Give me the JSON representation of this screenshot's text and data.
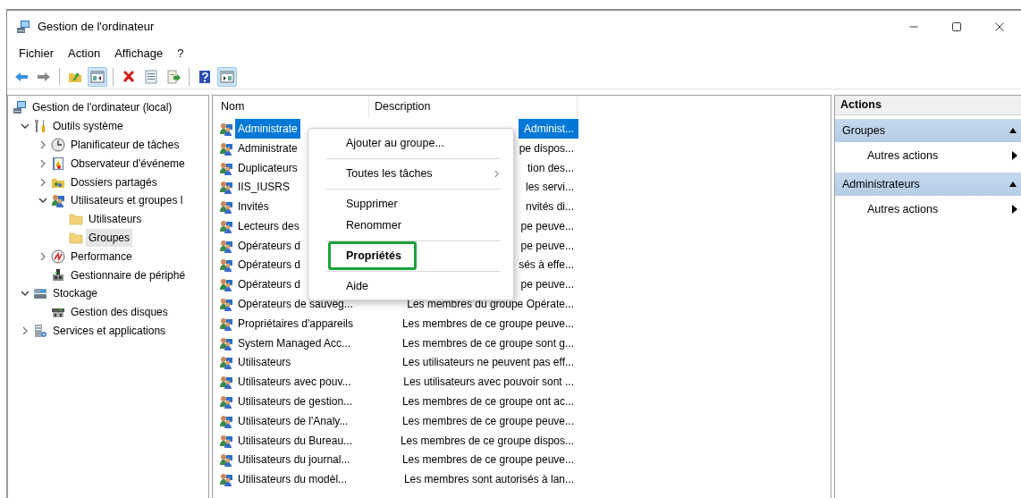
{
  "window": {
    "title": "Gestion de l'ordinateur"
  },
  "menu_bar": [
    "Fichier",
    "Action",
    "Affichage",
    "?"
  ],
  "toolbar": [
    {
      "kind": "back",
      "pressed": false
    },
    {
      "kind": "forward",
      "pressed": false
    },
    {
      "kind": "separator"
    },
    {
      "kind": "up",
      "pressed": false
    },
    {
      "kind": "tree-toggle",
      "pressed": true
    },
    {
      "kind": "separator"
    },
    {
      "kind": "delete",
      "pressed": false
    },
    {
      "kind": "properties",
      "pressed": false
    },
    {
      "kind": "export",
      "pressed": false
    },
    {
      "kind": "separator"
    },
    {
      "kind": "help",
      "pressed": false
    },
    {
      "kind": "actions-toggle",
      "pressed": true
    }
  ],
  "tree": [
    {
      "label": "Gestion de l'ordinateur (local)",
      "kind": "computer",
      "selected": false,
      "children": [
        {
          "label": "Outils système",
          "kind": "tools",
          "expanded": true,
          "selected": false,
          "children": [
            {
              "label": "Planificateur de tâches",
              "kind": "clock",
              "expanded": false,
              "selected": false
            },
            {
              "label": "Observateur d'événeme",
              "kind": "event",
              "expanded": false,
              "selected": false
            },
            {
              "label": "Dossiers partagés",
              "kind": "share",
              "expanded": false,
              "selected": false
            },
            {
              "label": "Utilisateurs et groupes l",
              "kind": "users",
              "expanded": true,
              "selected": false,
              "children": [
                {
                  "label": "Utilisateurs",
                  "kind": "folder",
                  "selected": false
                },
                {
                  "label": "Groupes",
                  "kind": "folder",
                  "selected": true
                }
              ]
            },
            {
              "label": "Performance",
              "kind": "perf",
              "expanded": false,
              "selected": false
            },
            {
              "label": "Gestionnaire de périphé",
              "kind": "device",
              "selected": false
            }
          ]
        },
        {
          "label": "Stockage",
          "kind": "storage",
          "expanded": true,
          "selected": false,
          "children": [
            {
              "label": "Gestion des disques",
              "kind": "disk",
              "selected": false
            }
          ]
        },
        {
          "label": "Services et applications",
          "kind": "services",
          "expanded": false,
          "selected": false
        }
      ]
    }
  ],
  "table": {
    "columns": [
      "Nom",
      "Description"
    ],
    "rows": [
      {
        "name": "Administrate",
        "description": "Administ...",
        "selected": true
      },
      {
        "name": "Administrate",
        "description": "pe dispos...",
        "selected": false
      },
      {
        "name": "Duplicateurs",
        "description": "tion des...",
        "selected": false
      },
      {
        "name": "IIS_IUSRS",
        "description": "les servi...",
        "selected": false
      },
      {
        "name": "Invités",
        "description": "nvités di...",
        "selected": false
      },
      {
        "name": "Lecteurs des",
        "description": "pe peuve...",
        "selected": false
      },
      {
        "name": "Opérateurs d",
        "description": "pe peuve...",
        "selected": false
      },
      {
        "name": "Opérateurs d",
        "description": "sés à effe...",
        "selected": false
      },
      {
        "name": "Opérateurs d",
        "description": "pe peuve...",
        "selected": false
      },
      {
        "name": "Opérateurs de sauveg...",
        "description": "Les membres du groupe Opérate...",
        "selected": false
      },
      {
        "name": "Propriétaires d'appareils",
        "description": "Les membres de ce groupe peuve...",
        "selected": false
      },
      {
        "name": "System Managed Acc...",
        "description": "Les membres de ce groupe sont g...",
        "selected": false
      },
      {
        "name": "Utilisateurs",
        "description": "Les utilisateurs ne peuvent pas eff...",
        "selected": false
      },
      {
        "name": "Utilisateurs avec pouv...",
        "description": "Les utilisateurs avec pouvoir sont ...",
        "selected": false
      },
      {
        "name": "Utilisateurs de gestion...",
        "description": "Les membres de ce groupe ont ac...",
        "selected": false
      },
      {
        "name": "Utilisateurs de l'Analy...",
        "description": "Les membres de ce groupe peuve...",
        "selected": false
      },
      {
        "name": "Utilisateurs du Bureau...",
        "description": "Les membres de ce groupe dispos...",
        "selected": false
      },
      {
        "name": "Utilisateurs du journal...",
        "description": "Les membres de ce groupe peuve...",
        "selected": false
      },
      {
        "name": "Utilisateurs du modèl...",
        "description": "Les membres sont autorisés à lan...",
        "selected": false
      }
    ]
  },
  "context_menu": [
    {
      "kind": "item",
      "label": "Ajouter au groupe...",
      "highlighted": false
    },
    {
      "kind": "separator"
    },
    {
      "kind": "submenu",
      "label": "Toutes les tâches",
      "highlighted": false
    },
    {
      "kind": "separator"
    },
    {
      "kind": "item",
      "label": "Supprimer",
      "highlighted": false
    },
    {
      "kind": "item",
      "label": "Renommer",
      "highlighted": false
    },
    {
      "kind": "separator"
    },
    {
      "kind": "default",
      "label": "Propriétés",
      "highlighted": true
    },
    {
      "kind": "separator"
    },
    {
      "kind": "item",
      "label": "Aide",
      "highlighted": false
    }
  ],
  "actions": {
    "title": "Actions",
    "sections": [
      {
        "title": "Groupes",
        "expanded": true,
        "items": [
          "Autres actions"
        ]
      },
      {
        "title": "Administrateurs",
        "expanded": true,
        "items": [
          "Autres actions"
        ]
      }
    ]
  }
}
